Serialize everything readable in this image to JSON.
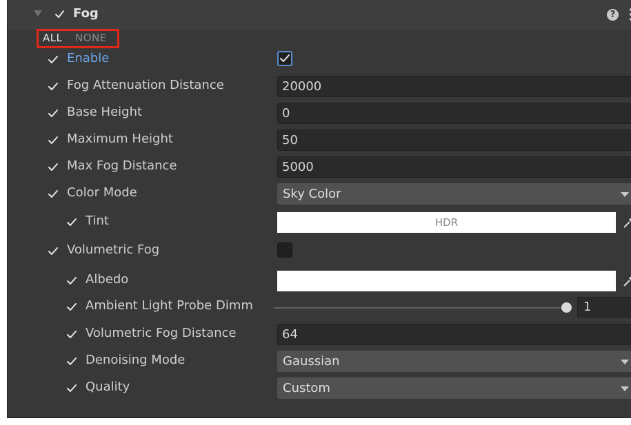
{
  "header": {
    "title": "Fog",
    "help_icon": "help-icon",
    "menu_icon": "more-options-icon"
  },
  "toggle_all": {
    "all_label": "ALL",
    "none_label": "NONE",
    "highlight_color": "#e0281c"
  },
  "rows": {
    "enable": {
      "label": "Enable"
    },
    "fog_attenuation_distance": {
      "label": "Fog Attenuation Distance",
      "value": "20000"
    },
    "base_height": {
      "label": "Base Height",
      "value": "0"
    },
    "maximum_height": {
      "label": "Maximum Height",
      "value": "50"
    },
    "max_fog_distance": {
      "label": "Max Fog Distance",
      "value": "5000"
    },
    "color_mode": {
      "label": "Color Mode",
      "value": "Sky Color"
    },
    "tint": {
      "label": "Tint",
      "value": "HDR"
    },
    "volumetric_fog": {
      "label": "Volumetric Fog"
    },
    "albedo": {
      "label": "Albedo"
    },
    "ambient_light_probe_dimmer": {
      "label": "Ambient Light Probe Dimm",
      "value": "1"
    },
    "volumetric_fog_distance": {
      "label": "Volumetric Fog Distance",
      "value": "64"
    },
    "denoising_mode": {
      "label": "Denoising Mode",
      "value": "Gaussian"
    },
    "quality": {
      "label": "Quality",
      "value": "Custom"
    }
  },
  "colors": {
    "panel_bg": "#383838",
    "field_bg": "#2a2a2a",
    "dropdown_bg": "#515151",
    "active_label": "#6aa6ea"
  }
}
